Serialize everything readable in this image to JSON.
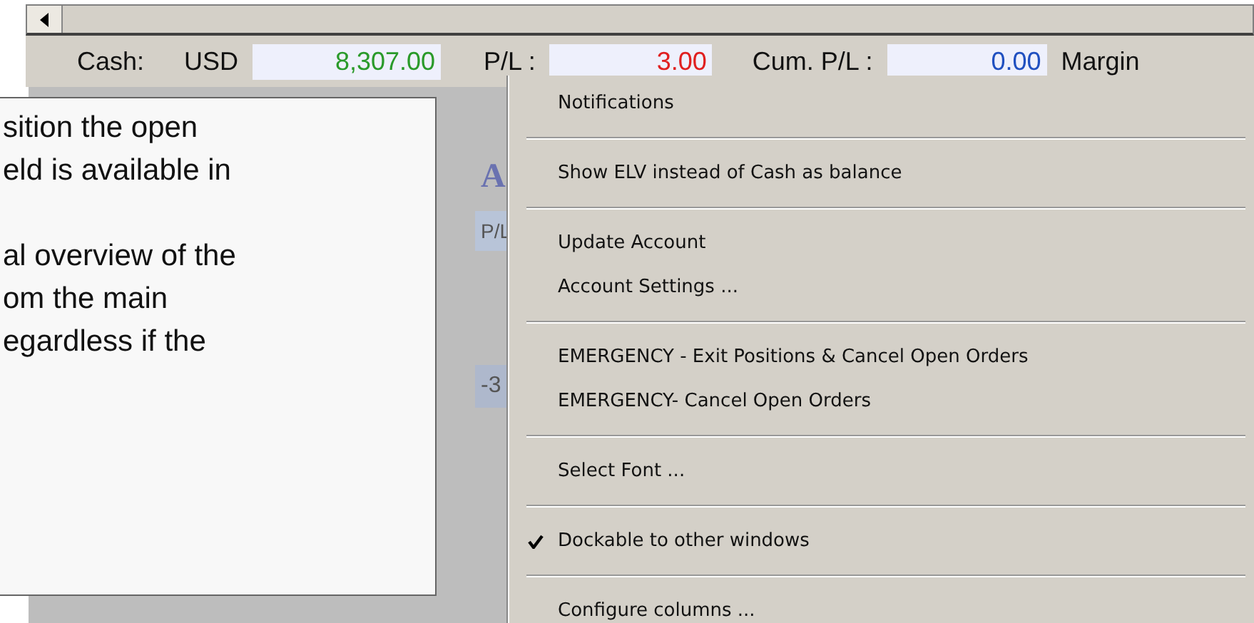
{
  "account_bar": {
    "cash_label": "Cash:",
    "currency": "USD",
    "cash_value": "8,307.00",
    "pl_label": "P/L :",
    "pl_value": "3.00",
    "cum_pl_label": "Cum. P/L :",
    "cum_pl_value": "0.00",
    "margin_label": "Margin"
  },
  "background_grid": {
    "header_glyph": "A",
    "column_header": "P/L",
    "cell": "-3"
  },
  "tooltip": {
    "paragraphs": [
      [
        "sition the open",
        "eld is available in"
      ],
      [
        "al overview of the",
        "om the main",
        "egardless if the"
      ]
    ]
  },
  "menu": {
    "items": [
      {
        "kind": "item",
        "label": "Notifications",
        "checked": false
      },
      {
        "kind": "separator"
      },
      {
        "kind": "item",
        "label": "Show ELV instead of Cash as balance",
        "checked": false
      },
      {
        "kind": "separator"
      },
      {
        "kind": "item",
        "label": "Update Account",
        "checked": false
      },
      {
        "kind": "item",
        "label": "Account Settings ...",
        "checked": false
      },
      {
        "kind": "separator"
      },
      {
        "kind": "item",
        "label": "EMERGENCY - Exit Positions & Cancel Open Orders",
        "checked": false
      },
      {
        "kind": "item",
        "label": "EMERGENCY- Cancel Open Orders",
        "checked": false
      },
      {
        "kind": "separator"
      },
      {
        "kind": "item",
        "label": "Select Font ...",
        "checked": false
      },
      {
        "kind": "separator"
      },
      {
        "kind": "item",
        "label": "Dockable to other windows",
        "checked": true
      },
      {
        "kind": "separator"
      },
      {
        "kind": "item",
        "label": "Configure columns ...",
        "checked": false
      }
    ]
  }
}
